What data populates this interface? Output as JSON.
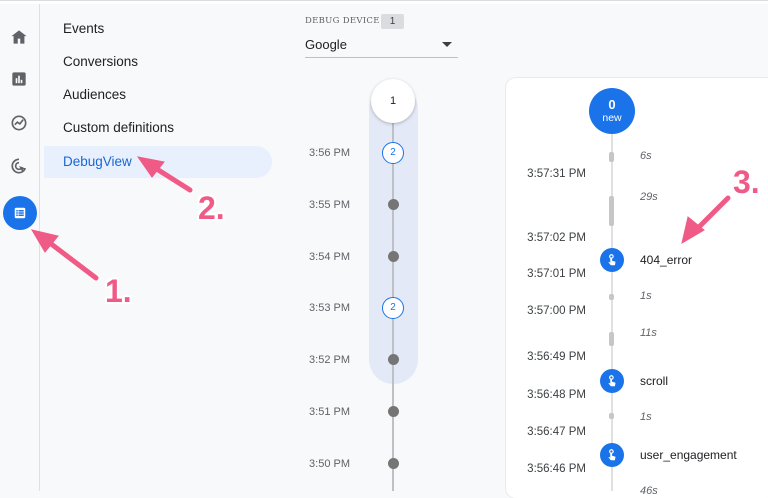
{
  "rail": {
    "icons": [
      "home-icon",
      "reports-icon",
      "explore-icon",
      "advertising-icon",
      "configure-icon"
    ],
    "active_color": "#1a73e8"
  },
  "menu": {
    "items": [
      {
        "label": "Events"
      },
      {
        "label": "Conversions"
      },
      {
        "label": "Audiences"
      },
      {
        "label": "Custom definitions"
      },
      {
        "label": "DebugView"
      }
    ],
    "active_index": 4
  },
  "debug_device": {
    "label": "DEBUG DEVICE",
    "count": "1",
    "selected": "Google"
  },
  "minutes": {
    "top_count": "1",
    "rows": [
      {
        "time": "3:56 PM",
        "count": "2"
      },
      {
        "time": "3:55 PM",
        "count": null
      },
      {
        "time": "3:54 PM",
        "count": null
      },
      {
        "time": "3:53 PM",
        "count": "2"
      },
      {
        "time": "3:52 PM",
        "count": null
      },
      {
        "time": "3:51 PM",
        "count": null
      },
      {
        "time": "3:50 PM",
        "count": null
      }
    ]
  },
  "seconds": {
    "new_count": "0",
    "new_label": "new",
    "times": [
      "3:57:31 PM",
      "3:57:02 PM",
      "3:57:01 PM",
      "3:57:00 PM",
      "3:56:49 PM",
      "3:56:48 PM",
      "3:56:47 PM",
      "3:56:46 PM"
    ],
    "gaps": [
      "6s",
      "29s",
      "1s",
      "11s",
      "1s",
      "46s"
    ],
    "events": [
      {
        "name": "404_error"
      },
      {
        "name": "scroll"
      },
      {
        "name": "user_engagement"
      }
    ]
  },
  "annotations": {
    "one": "1.",
    "two": "2.",
    "three": "3.",
    "color": "#f05a87"
  }
}
